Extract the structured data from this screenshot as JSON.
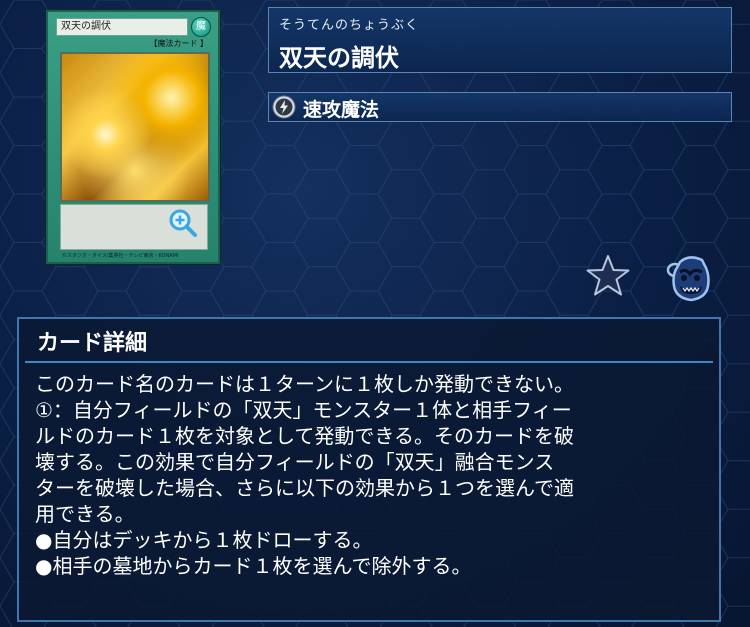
{
  "card": {
    "name": "双天の調伏",
    "ruby": "そうてんのちょうぶく",
    "attribute_glyph": "魔",
    "type_tag": "【魔法カード  】",
    "footer": "©スタジオ・ダイス/集英社・テレビ東京・KONAMI",
    "zoom_icon": "zoom-in-icon"
  },
  "spell_type": {
    "label": "速攻魔法",
    "icon": "quick-play-spell-icon"
  },
  "actions": {
    "favorite_icon": "star-icon",
    "deck_icon": "pot-icon"
  },
  "detail": {
    "heading": "カード詳細",
    "lines": [
      "このカード名のカードは１ターンに１枚しか発動できない。",
      "①：自分フィールドの「双天」モンスター１体と相手フィー",
      "ルドのカード１枚を対象として発動できる。そのカードを破",
      "壊する。この効果で自分フィールドの「双天」融合モンス",
      "ターを破壊した場合、さらに以下の効果から１つを選んで適",
      "用できる。",
      "●自分はデッキから１枚ドローする。",
      "●相手の墓地からカード１枚を選んで除外する。"
    ]
  },
  "colors": {
    "background": "#0b1f45",
    "panel_border": "#3f76ad",
    "card_frame": "#2f9a7f"
  }
}
